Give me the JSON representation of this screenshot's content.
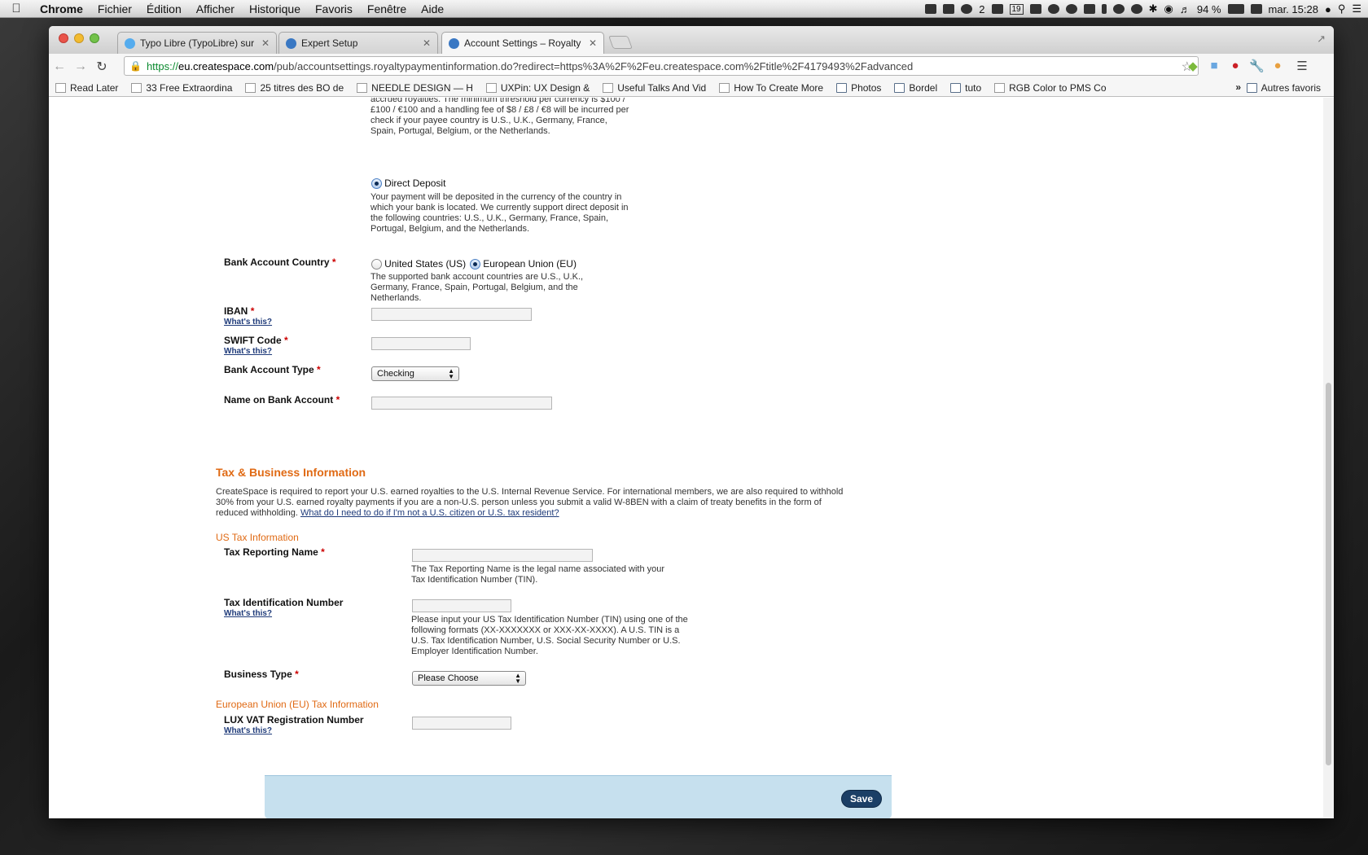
{
  "menubar": {
    "app": "Chrome",
    "items": [
      "Fichier",
      "Édition",
      "Afficher",
      "Historique",
      "Favoris",
      "Fenêtre",
      "Aide"
    ],
    "status": {
      "notif_count": "2",
      "calendar_day": "19",
      "battery": "94 %",
      "clock": "mar. 15:28"
    }
  },
  "browser": {
    "tabs": [
      {
        "title": "Typo Libre (TypoLibre) sur T",
        "favicon_color": "#55acee"
      },
      {
        "title": "Expert Setup",
        "favicon_color": "#3a78c3"
      },
      {
        "title": "Account Settings – Royalty P",
        "favicon_color": "#3a78c3"
      }
    ],
    "url_scheme": "https://",
    "url_host": "eu.createspace.com",
    "url_path": "/pub/accountsettings.royaltypaymentinformation.do?redirect=https%3A%2F%2Feu.createspace.com%2Ftitle%2F4179493%2Fadvanced",
    "bookmarks": [
      {
        "label": "Read Later",
        "icon": "page-icon"
      },
      {
        "label": "33 Free Extraordina",
        "icon": "page-icon"
      },
      {
        "label": "25 titres des BO de",
        "icon": "page-icon"
      },
      {
        "label": "NEEDLE DESIGN — H",
        "icon": "page-icon"
      },
      {
        "label": "UXPin: UX Design &",
        "icon": "page-icon"
      },
      {
        "label": "Useful Talks And Vid",
        "icon": "page-icon"
      },
      {
        "label": "How To Create More",
        "icon": "page-icon"
      },
      {
        "label": "Photos",
        "icon": "folder-icon"
      },
      {
        "label": "Bordel",
        "icon": "folder-icon"
      },
      {
        "label": "tuto",
        "icon": "folder-icon"
      },
      {
        "label": "RGB Color to PMS Co",
        "icon": "page-icon"
      }
    ],
    "bookmarks_more": "»",
    "other_bookmarks": "Autres favoris"
  },
  "payment": {
    "check_text_tail": "accrued royalties. The minimum threshold per currency is $100 / £100 / €100 and a handling fee of $8 / £8 / €8 will be incurred per check if your payee country is U.S., U.K., Germany, France, Spain, Portugal, Belgium, or the Netherlands.",
    "direct_deposit_label": "Direct Deposit",
    "direct_deposit_desc": "Your payment will be deposited in the currency of the country in which your bank is located. We currently support direct deposit in the following countries: U.S., U.K., Germany, France, Spain, Portugal, Belgium, and the Netherlands.",
    "bank_country_label": "Bank Account Country",
    "bank_country_us": "United States (US)",
    "bank_country_eu": "European Union (EU)",
    "bank_country_note": "The supported bank account countries are U.S., U.K., Germany, France, Spain, Portugal, Belgium, and the Netherlands.",
    "iban_label": "IBAN",
    "swift_label": "SWIFT Code",
    "account_type_label": "Bank Account Type",
    "account_type_value": "Checking",
    "name_label": "Name on Bank Account",
    "whats_this": "What's this?",
    "required_mark": "*"
  },
  "tax": {
    "heading": "Tax & Business Information",
    "intro": "CreateSpace is required to report your U.S. earned royalties to the U.S. Internal Revenue Service. For international members, we are also required to withhold 30% from your U.S. earned royalty payments if you are a non-U.S. person unless you submit a valid W-8BEN with a claim of treaty benefits in the form of reduced withholding.",
    "intro_link": "What do I need to do if I'm not a U.S. citizen or U.S. tax resident?",
    "us_heading": "US Tax Information",
    "reporting_name_label": "Tax Reporting Name",
    "reporting_name_help": "The Tax Reporting Name is the legal name associated with your Tax Identification Number (TIN).",
    "tin_label": "Tax Identification Number",
    "tin_help": "Please input your US Tax Identification Number (TIN) using one of the following formats (XX-XXXXXXX or XXX-XX-XXXX). A U.S. TIN is a U.S. Tax Identification Number, U.S. Social Security Number or U.S. Employer Identification Number.",
    "business_type_label": "Business Type",
    "business_type_value": "Please Choose",
    "eu_heading": "European Union (EU) Tax Information",
    "vat_label": "LUX VAT Registration Number"
  },
  "footer": {
    "save_label": "Save"
  }
}
